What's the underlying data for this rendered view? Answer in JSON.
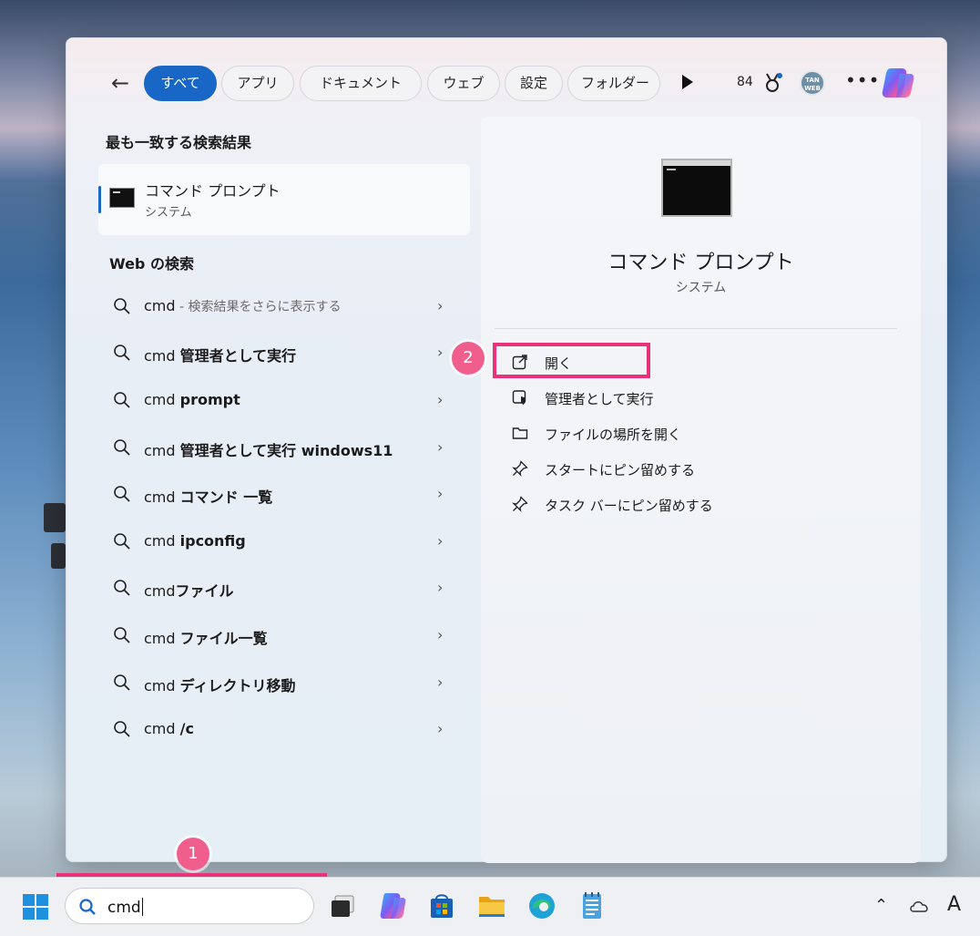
{
  "filters": {
    "tabs": [
      {
        "label": "すべて",
        "active": true
      },
      {
        "label": "アプリ",
        "active": false
      },
      {
        "label": "ドキュメント",
        "active": false
      },
      {
        "label": "ウェブ",
        "active": false
      },
      {
        "label": "設定",
        "active": false
      },
      {
        "label": "フォルダー",
        "active": false
      }
    ],
    "points": "84",
    "avatar_text": "TAN WEB"
  },
  "best_match": {
    "heading": "最も一致する検索結果",
    "name": "コマンド プロンプト",
    "type": "システム"
  },
  "web_search": {
    "heading": "Web の検索",
    "items": [
      {
        "prefix": "cmd",
        "bold": "",
        "note": " - 検索結果をさらに表示する"
      },
      {
        "prefix": "cmd ",
        "bold": "管理者として実行",
        "note": ""
      },
      {
        "prefix": "cmd ",
        "bold": "prompt",
        "note": ""
      },
      {
        "prefix": "cmd ",
        "bold": "管理者として実行 windows11",
        "note": ""
      },
      {
        "prefix": "cmd ",
        "bold": "コマンド 一覧",
        "note": ""
      },
      {
        "prefix": "cmd ",
        "bold": "ipconfig",
        "note": ""
      },
      {
        "prefix": "cmd",
        "bold": "ファイル",
        "note": ""
      },
      {
        "prefix": "cmd ",
        "bold": "ファイル一覧",
        "note": ""
      },
      {
        "prefix": "cmd ",
        "bold": "ディレクトリ移動",
        "note": ""
      },
      {
        "prefix": "cmd ",
        "bold": "/c",
        "note": ""
      }
    ]
  },
  "detail": {
    "name": "コマンド プロンプト",
    "type": "システム",
    "actions": [
      {
        "label": "開く",
        "icon": "open-external-icon"
      },
      {
        "label": "管理者として実行",
        "icon": "shield-run-icon"
      },
      {
        "label": "ファイルの場所を開く",
        "icon": "folder-icon"
      },
      {
        "label": "スタートにピン留めする",
        "icon": "pin-icon"
      },
      {
        "label": "タスク バーにピン留めする",
        "icon": "pin-icon"
      }
    ]
  },
  "callouts": {
    "one": "1",
    "two": "2"
  },
  "taskbar": {
    "search_value": "cmd",
    "apps": [
      "task-view-icon",
      "copilot-icon",
      "store-icon",
      "file-explorer-icon",
      "edge-icon",
      "notepad-icon"
    ],
    "tray": {
      "ime": "A"
    }
  },
  "colors": {
    "accent": "#1866c6",
    "highlight": "#e8337a",
    "badge": "#ef5e8d"
  }
}
